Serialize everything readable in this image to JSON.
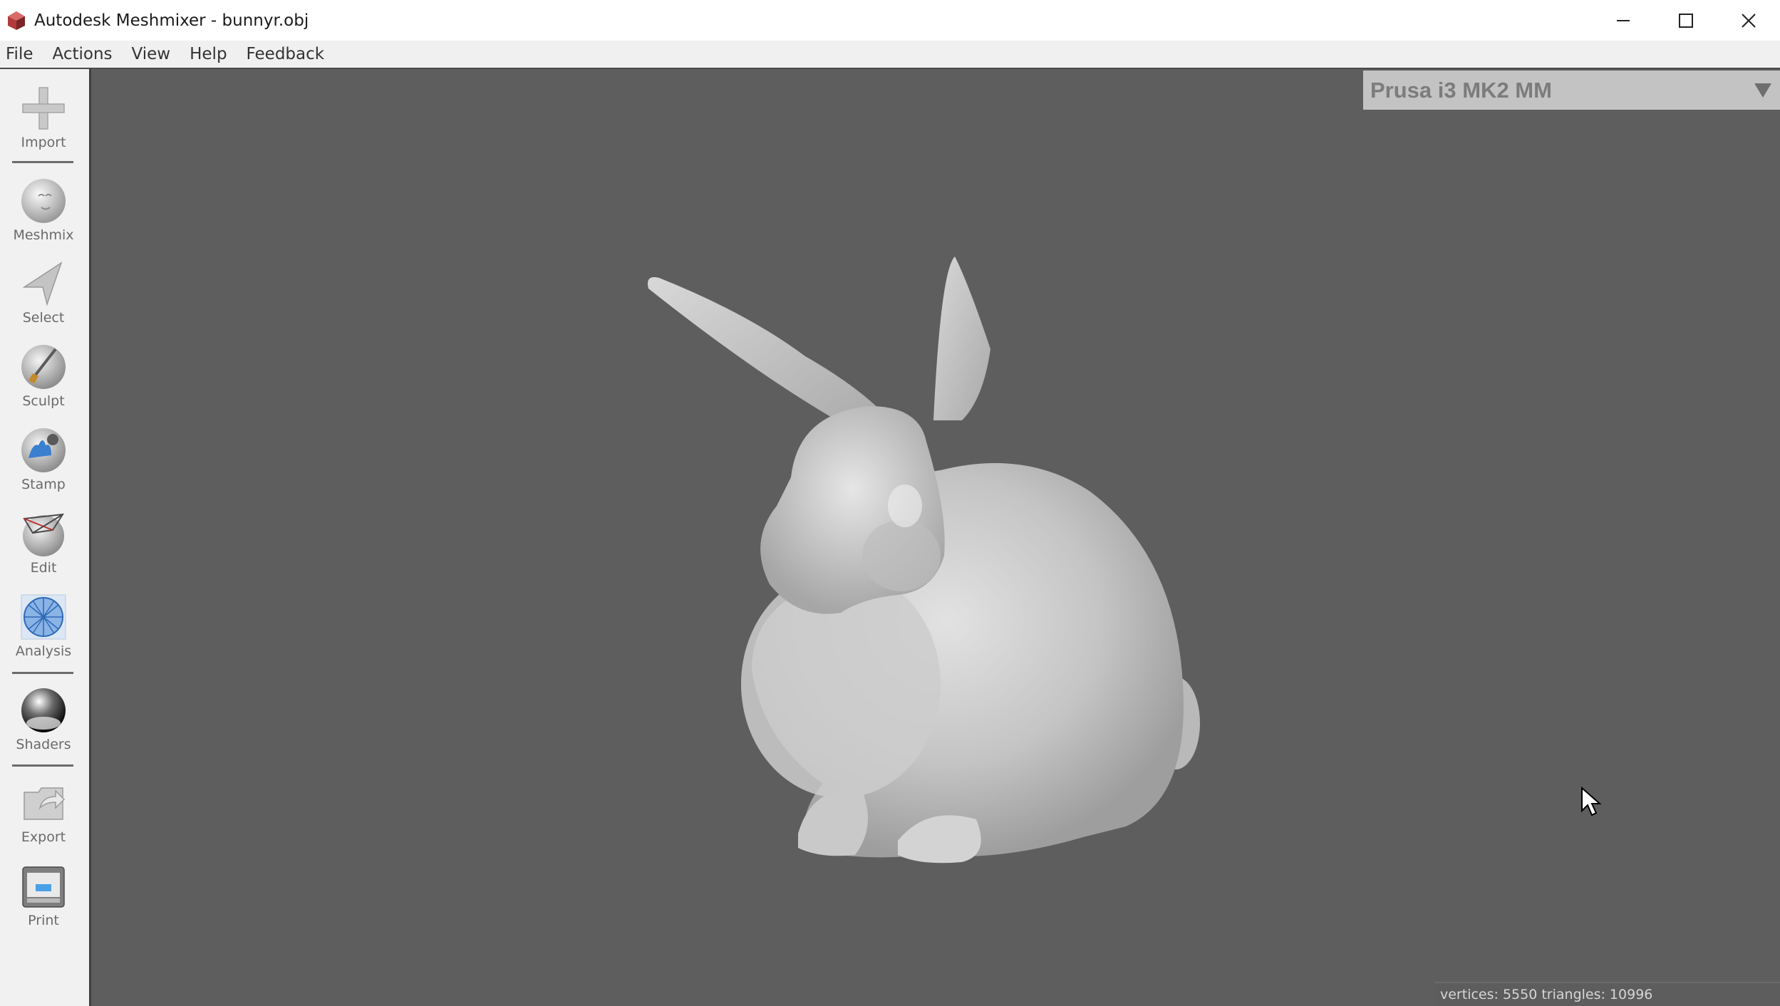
{
  "window": {
    "title": "Autodesk Meshmixer - bunnyr.obj",
    "controls": [
      "minimize-icon",
      "maximize-icon",
      "close-icon"
    ]
  },
  "menu": {
    "items": [
      "File",
      "Actions",
      "View",
      "Help",
      "Feedback"
    ]
  },
  "toolbar": {
    "tools": [
      {
        "label": "Import",
        "icon": "plus-icon"
      },
      {
        "label": "Meshmix",
        "icon": "meshmix-sphere-icon"
      },
      {
        "label": "Select",
        "icon": "select-arrow-icon"
      },
      {
        "label": "Sculpt",
        "icon": "sculpt-brush-icon"
      },
      {
        "label": "Stamp",
        "icon": "stamp-icon"
      },
      {
        "label": "Edit",
        "icon": "edit-icon"
      },
      {
        "label": "Analysis",
        "icon": "analysis-icon"
      },
      {
        "label": "Shaders",
        "icon": "shaders-icon"
      },
      {
        "label": "Export",
        "icon": "export-icon"
      },
      {
        "label": "Print",
        "icon": "print-icon"
      }
    ]
  },
  "viewport": {
    "printer": "Prusa i3 MK2 MM",
    "status": "vertices: 5550 triangles: 10996"
  },
  "colors": {
    "viewport_bg": "#5e5e5e",
    "toolbar_bg": "#f1f1f1",
    "printer_bg": "#c3c3c3",
    "mesh": "#c8c8c8"
  }
}
